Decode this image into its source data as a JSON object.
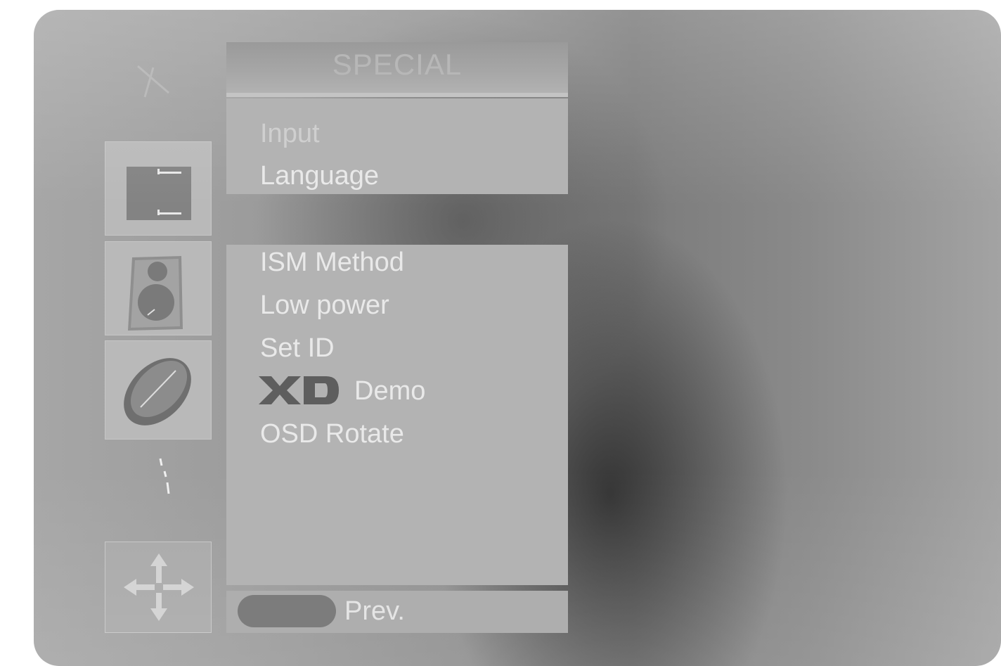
{
  "menu": {
    "title": "SPECIAL",
    "top_items": [
      {
        "label": "Input"
      },
      {
        "label": "Language"
      }
    ],
    "items": [
      {
        "label": "ISM Method"
      },
      {
        "label": "Low power"
      },
      {
        "label": "Set ID"
      },
      {
        "label": "Demo",
        "logo": "XD"
      },
      {
        "label": "OSD Rotate"
      }
    ]
  },
  "sidebar": {
    "icons": [
      {
        "name": "screen-icon"
      },
      {
        "name": "speaker-icon"
      },
      {
        "name": "disc-icon"
      },
      {
        "name": "move-arrows-icon"
      }
    ]
  },
  "footer": {
    "button_label": "Prev."
  },
  "colors": {
    "panel": "#b3b3b3",
    "text": "#e9e9e9",
    "button": "#7c7c7c"
  }
}
